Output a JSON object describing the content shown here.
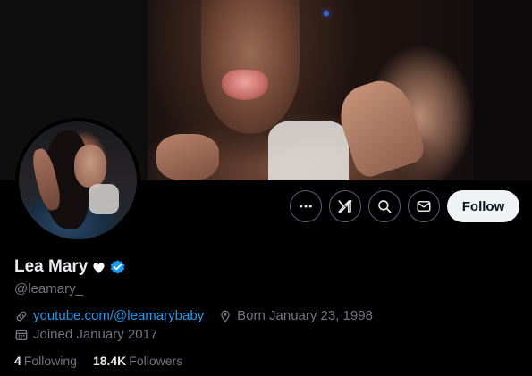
{
  "profile": {
    "display_name": "Lea Mary",
    "handle": "@leamary_",
    "name_emoji": "heart-on-fire-emoji",
    "verified": true,
    "link": "youtube.com/@leamarybaby",
    "born": "Born January 23, 1998",
    "joined": "Joined January 2017",
    "following_count": "4",
    "following_label": "Following",
    "followers_count": "18.4K",
    "followers_label": "Followers"
  },
  "actions": {
    "more": "more-icon",
    "grok": "grok-icon",
    "search": "search-icon",
    "message": "envelope-icon",
    "follow_label": "Follow"
  },
  "colors": {
    "background": "#000000",
    "link": "#1d9bf0",
    "verified": "#1d9bf0",
    "muted": "#71767b",
    "text": "#e7e9ea",
    "follow_bg": "#eff3f4"
  }
}
